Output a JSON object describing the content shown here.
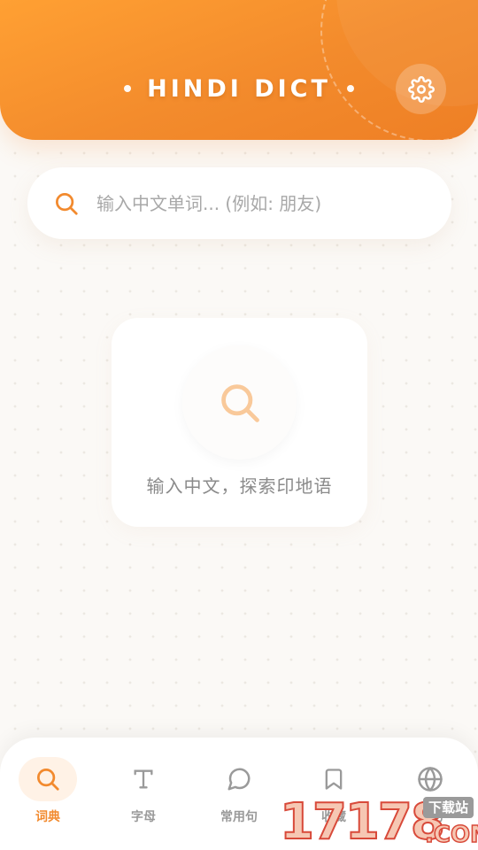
{
  "header": {
    "title": "HINDI DICT",
    "settings_icon": "gear-icon"
  },
  "search": {
    "placeholder": "输入中文单词... (例如: 朋友)",
    "value": "",
    "icon": "search-icon"
  },
  "empty_state": {
    "icon": "search-icon",
    "message": "输入中文，探索印地语"
  },
  "bottom_nav": {
    "items": [
      {
        "label": "词典",
        "icon": "search-icon",
        "active": true
      },
      {
        "label": "字母",
        "icon": "text-icon",
        "active": false
      },
      {
        "label": "常用句",
        "icon": "chat-bubble-icon",
        "active": false
      },
      {
        "label": "收藏",
        "icon": "bookmark-icon",
        "active": false
      },
      {
        "label": "文化",
        "icon": "globe-icon",
        "active": false
      }
    ]
  },
  "watermark": {
    "digits": "17178",
    "top_text": "下载站",
    "domain": ".COM"
  },
  "colors": {
    "accent": "#f28a2e",
    "header_start": "#ffa033",
    "header_end": "#ee7f25",
    "inactive": "#9a9a9a",
    "background": "#fbf9f6"
  }
}
